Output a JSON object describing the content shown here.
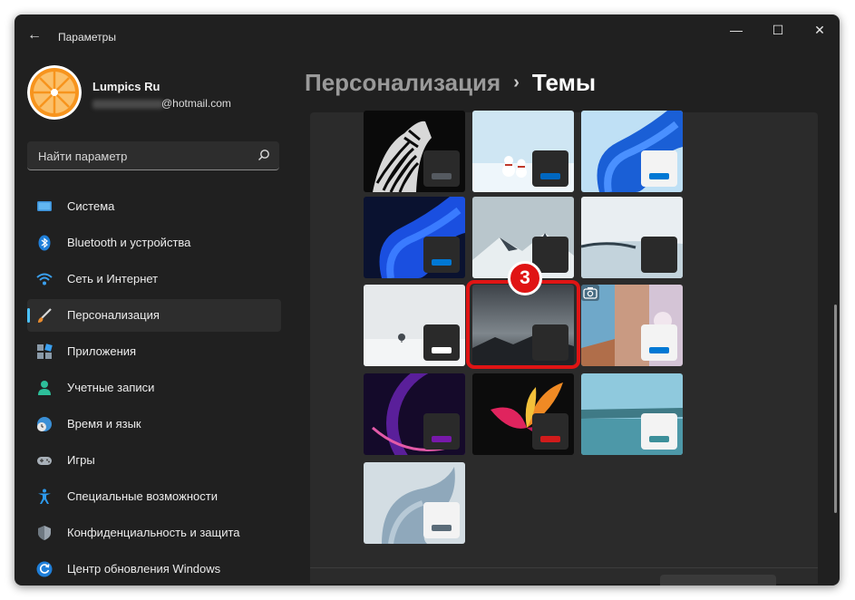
{
  "window": {
    "title": "Параметры",
    "controls": {
      "minimize": "—",
      "maximize": "☐",
      "close": "✕"
    }
  },
  "user": {
    "name": "Lumpics Ru",
    "email_suffix": "@hotmail.com"
  },
  "search": {
    "placeholder": "Найти параметр"
  },
  "sidebar": {
    "items": [
      {
        "label": "Система",
        "icon": "system-icon"
      },
      {
        "label": "Bluetooth и устройства",
        "icon": "bluetooth-icon"
      },
      {
        "label": "Сеть и Интернет",
        "icon": "wifi-icon"
      },
      {
        "label": "Персонализация",
        "icon": "brush-icon",
        "active": true
      },
      {
        "label": "Приложения",
        "icon": "apps-icon"
      },
      {
        "label": "Учетные записи",
        "icon": "account-icon"
      },
      {
        "label": "Время и язык",
        "icon": "clock-globe-icon"
      },
      {
        "label": "Игры",
        "icon": "gamepad-icon"
      },
      {
        "label": "Специальные возможности",
        "icon": "accessibility-icon"
      },
      {
        "label": "Конфиденциальность и защита",
        "icon": "shield-icon"
      },
      {
        "label": "Центр обновления Windows",
        "icon": "update-icon"
      }
    ]
  },
  "breadcrumb": {
    "parent": "Персонализация",
    "separator": "›",
    "current": "Темы"
  },
  "themes": [
    {
      "name": "zebra",
      "swatch_bg": "#2a2a2a",
      "accent": "#555a60"
    },
    {
      "name": "snowmen",
      "swatch_bg": "#2a2a2a",
      "accent": "#0067c0"
    },
    {
      "name": "bloom-light",
      "swatch_bg": "#f3f3f3",
      "accent": "#0078d4"
    },
    {
      "name": "bloom-dark",
      "swatch_bg": "#2a2a2a",
      "accent": "#0078d4"
    },
    {
      "name": "snowy-mountain",
      "swatch_bg": "#2a2a2a",
      "accent": "#2a2a2a"
    },
    {
      "name": "frozen-lake",
      "swatch_bg": "#2a2a2a",
      "accent": "#2a2a2a"
    },
    {
      "name": "lone-tree",
      "swatch_bg": "#2a2a2a",
      "accent": "#ffffff"
    },
    {
      "name": "dark-clouds",
      "swatch_bg": "#2a2a2a",
      "accent": "#2a2a2a",
      "selected": true
    },
    {
      "name": "spotlight",
      "swatch_bg": "#f3f3f3",
      "accent": "#0078d4"
    },
    {
      "name": "glow",
      "swatch_bg": "#2a2a2a",
      "accent": "#7719aa"
    },
    {
      "name": "captured-motion",
      "swatch_bg": "#2a2a2a",
      "accent": "#d11b1b"
    },
    {
      "name": "flow",
      "swatch_bg": "#f3f3f3",
      "accent": "#3c8f9a"
    },
    {
      "name": "sunrise",
      "swatch_bg": "#f3f3f3",
      "accent": "#5a6b78"
    }
  ],
  "step_badge": "3",
  "colors": {
    "accent": "#4cc2ff",
    "highlight": "#e01414"
  }
}
